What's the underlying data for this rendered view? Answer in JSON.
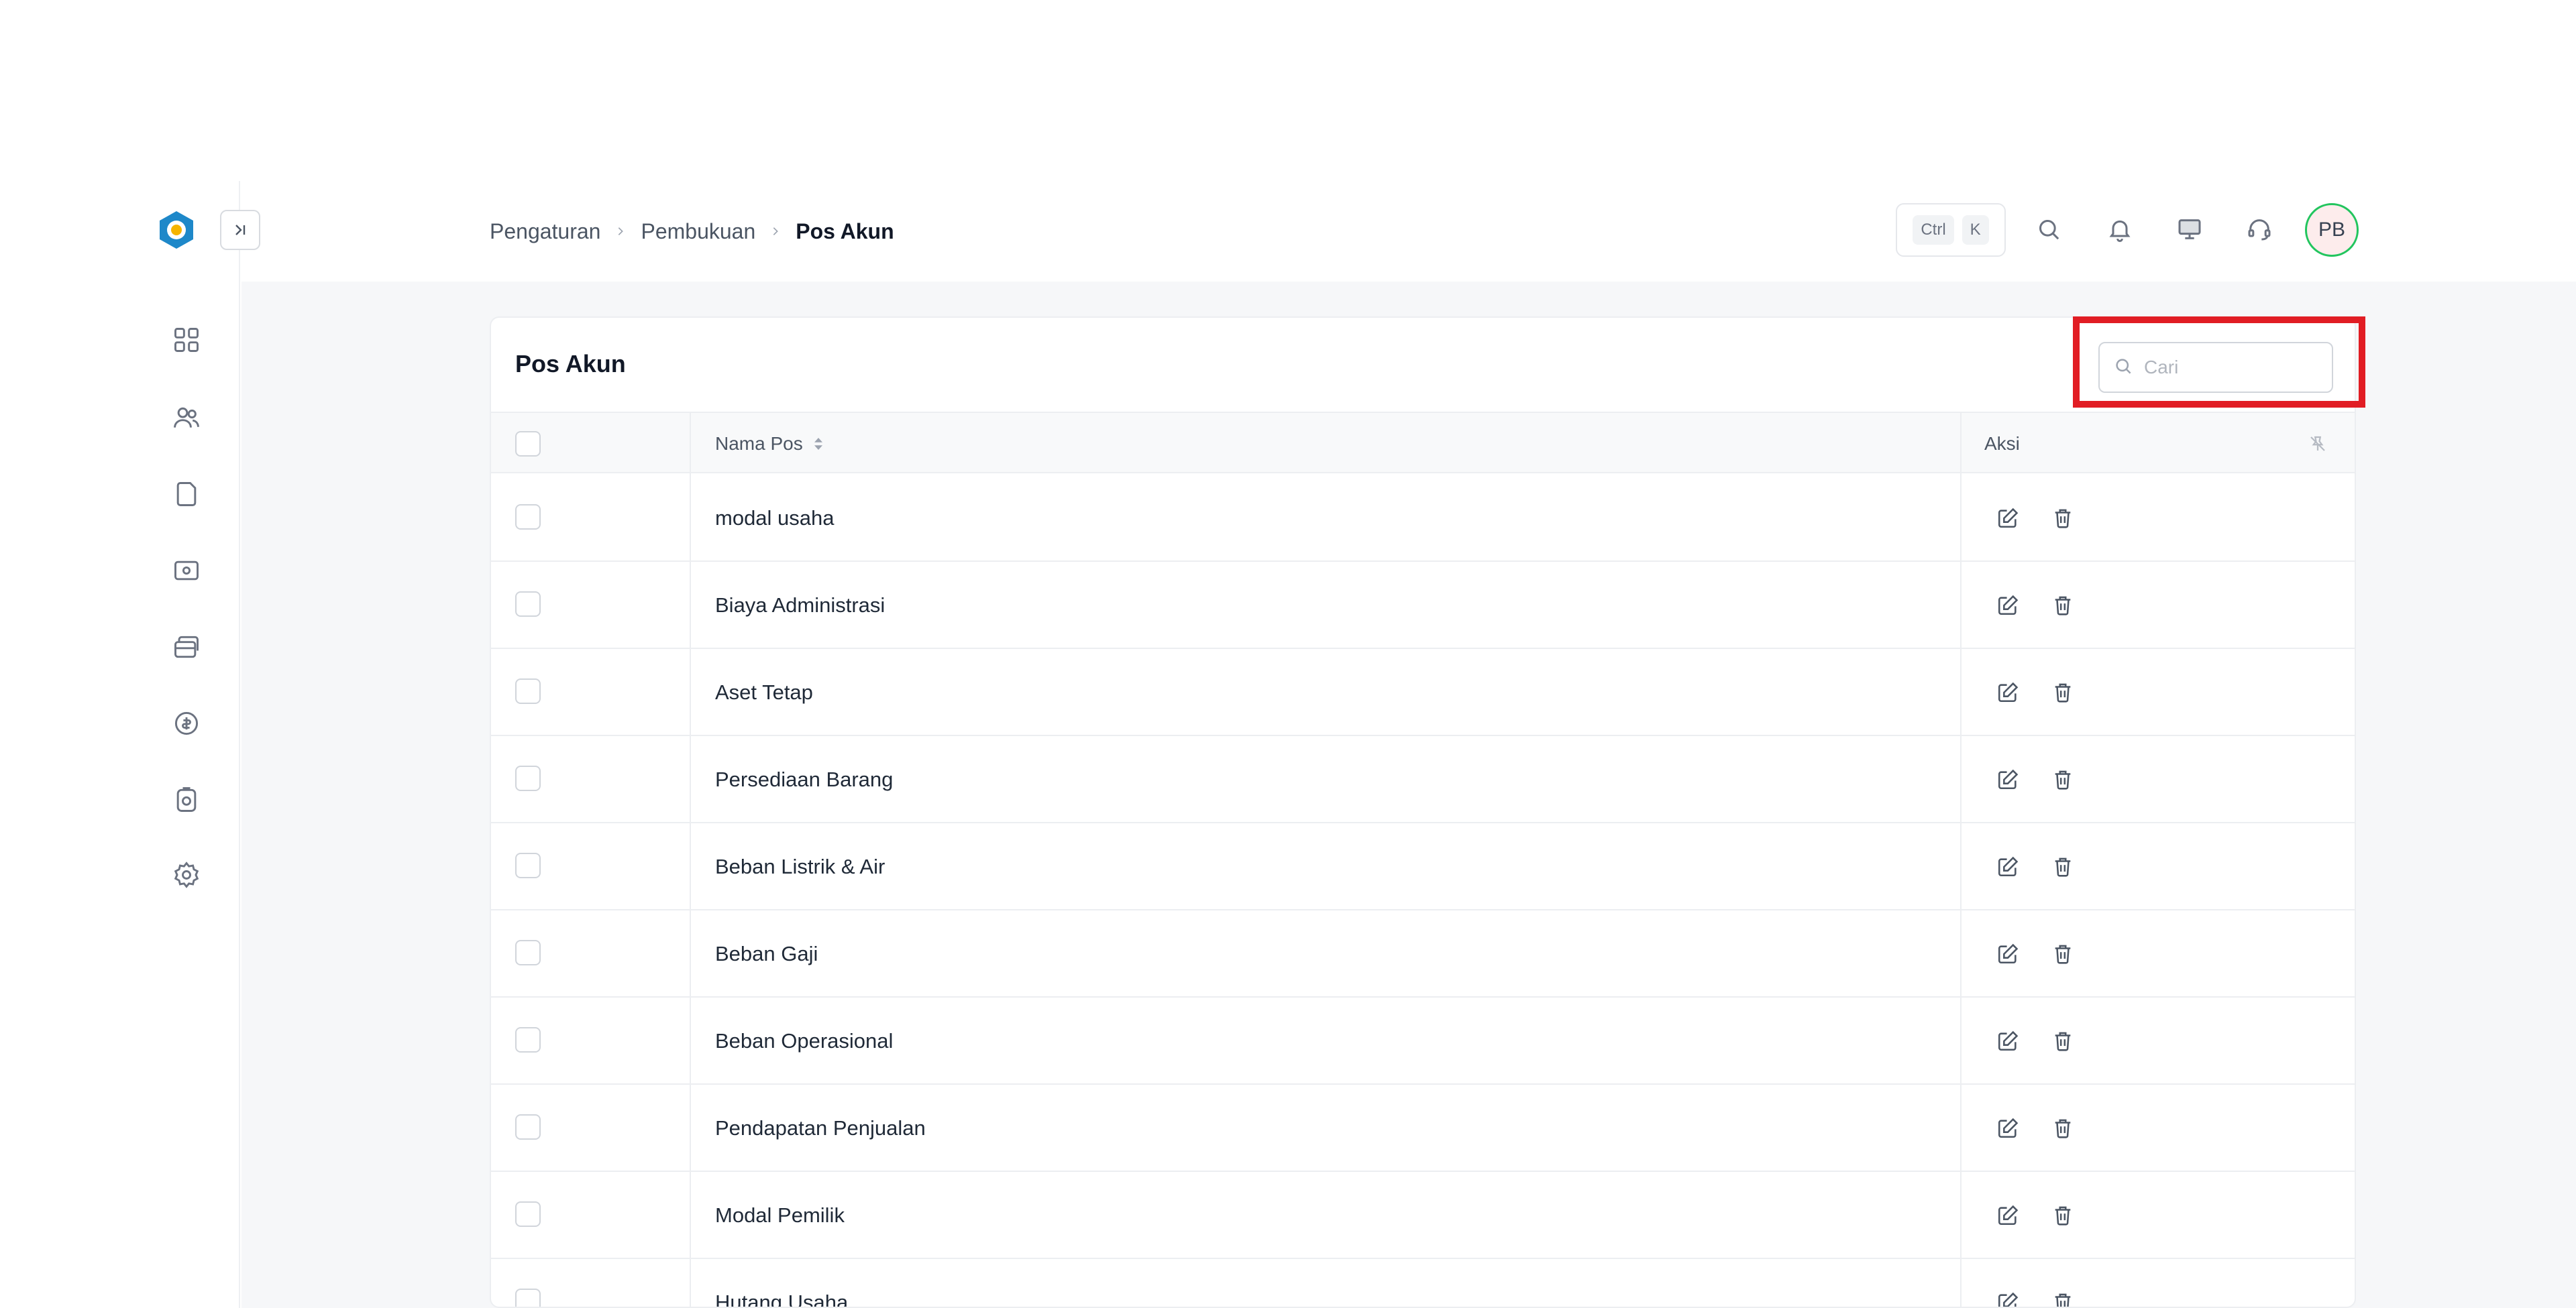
{
  "breadcrumb": [
    "Pengaturan",
    "Pembukuan",
    "Pos Akun"
  ],
  "header": {
    "shortcut_keys": [
      "Ctrl",
      "K"
    ],
    "icons": [
      "search-icon",
      "bell-icon",
      "monitor-icon",
      "headset-icon"
    ],
    "avatar_initials": "PB"
  },
  "sidebar": {
    "icons": [
      "dashboard-icon",
      "users-icon",
      "document-icon",
      "cash-icon",
      "wallet-icon",
      "coin-icon",
      "box-icon",
      "gear-icon"
    ]
  },
  "card": {
    "title": "Pos Akun",
    "search_placeholder": "Cari",
    "columns": {
      "name": "Nama Pos",
      "action": "Aksi"
    },
    "rows": [
      "modal usaha",
      "Biaya Administrasi",
      "Aset Tetap",
      "Persediaan Barang",
      "Beban Listrik & Air",
      "Beban Gaji",
      "Beban Operasional",
      "Pendapatan Penjualan",
      "Modal Pemilik",
      "Hutang Usaha"
    ]
  },
  "colors": {
    "highlight": "#e11d24",
    "avatar_ring": "#22c55e"
  }
}
